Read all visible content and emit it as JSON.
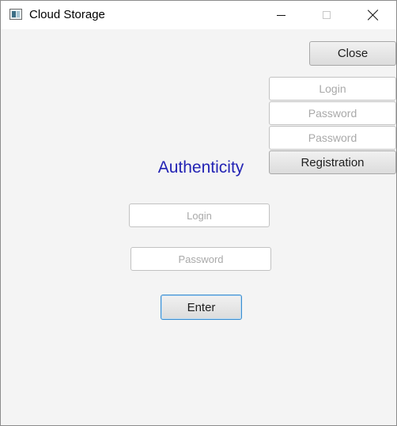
{
  "window": {
    "title": "Cloud Storage"
  },
  "toolbar": {
    "close_label": "Close"
  },
  "registration": {
    "login_placeholder": "Login",
    "password_placeholder": "Password",
    "password_confirm_placeholder": "Password",
    "button_label": "Registration"
  },
  "auth": {
    "heading": "Authenticity",
    "login_placeholder": "Login",
    "password_placeholder": "Password",
    "enter_label": "Enter"
  },
  "colors": {
    "heading": "#2323b4",
    "enter_border": "#3d8ecf",
    "background": "#f4f4f4"
  }
}
